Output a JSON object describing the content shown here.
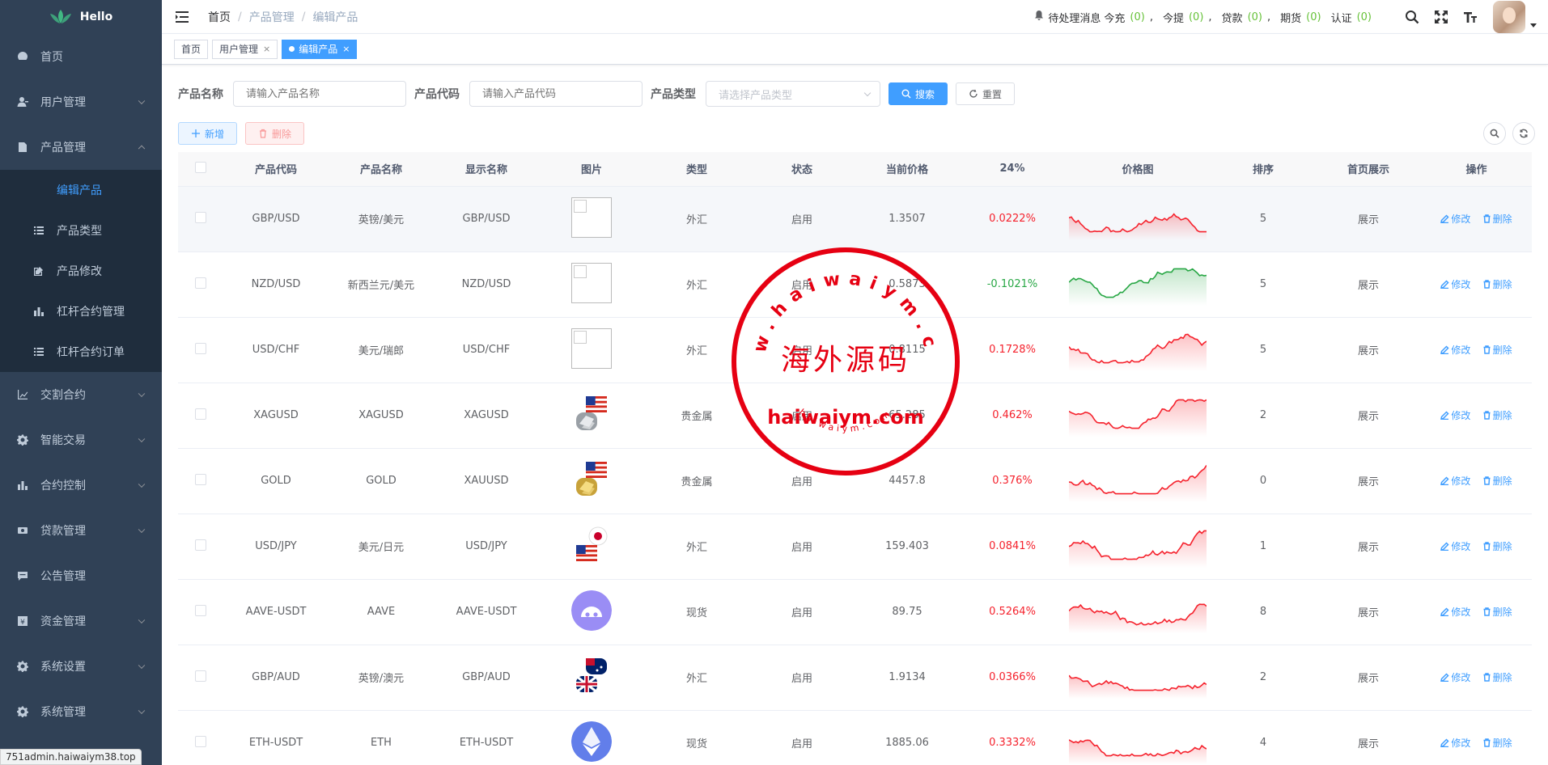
{
  "app": {
    "logo_text": "Hello",
    "status_url": "751admin.haiwaiym38.top"
  },
  "sidebar": {
    "items": [
      {
        "label": "首页",
        "icon": "dashboard-icon",
        "arrow": false
      },
      {
        "label": "用户管理",
        "icon": "user-icon",
        "arrow": true
      },
      {
        "label": "产品管理",
        "icon": "document-icon",
        "arrow": true,
        "open": true,
        "children": [
          {
            "label": "编辑产品",
            "icon": "",
            "active": true
          },
          {
            "label": "产品类型",
            "icon": "list-icon"
          },
          {
            "label": "产品修改",
            "icon": "edit-icon"
          },
          {
            "label": "杠杆合约管理",
            "icon": "bar-chart-icon"
          },
          {
            "label": "杠杆合约订单",
            "icon": "list-icon"
          }
        ]
      },
      {
        "label": "交割合约",
        "icon": "trend-icon",
        "arrow": true
      },
      {
        "label": "智能交易",
        "icon": "cog-icon",
        "arrow": true
      },
      {
        "label": "合约控制",
        "icon": "bar-chart-icon",
        "arrow": true
      },
      {
        "label": "贷款管理",
        "icon": "loan-icon",
        "arrow": true
      },
      {
        "label": "公告管理",
        "icon": "message-icon",
        "arrow": false
      },
      {
        "label": "资金管理",
        "icon": "money-icon",
        "arrow": true
      },
      {
        "label": "系统设置",
        "icon": "gear-icon",
        "arrow": true
      },
      {
        "label": "系统管理",
        "icon": "gear-icon",
        "arrow": true
      }
    ]
  },
  "header": {
    "breadcrumb": [
      "首页",
      "产品管理",
      "编辑产品"
    ],
    "notice": {
      "label": "待处理消息",
      "items": [
        {
          "label": "今充",
          "count": "(0)"
        },
        {
          "label": "今提",
          "count": "(0)"
        },
        {
          "label": "贷款",
          "count": "(0)"
        },
        {
          "label": "期货",
          "count": "(0)"
        },
        {
          "label": "认证",
          "count": "(0)"
        }
      ]
    }
  },
  "tags": [
    {
      "label": "首页",
      "active": false,
      "closable": false
    },
    {
      "label": "用户管理",
      "active": false,
      "closable": true
    },
    {
      "label": "编辑产品",
      "active": true,
      "closable": true
    }
  ],
  "search": {
    "name_label": "产品名称",
    "name_placeholder": "请输入产品名称",
    "code_label": "产品代码",
    "code_placeholder": "请输入产品代码",
    "type_label": "产品类型",
    "type_placeholder": "请选择产品类型",
    "search_btn": "搜索",
    "reset_btn": "重置"
  },
  "actions": {
    "add": "新增",
    "delete": "删除"
  },
  "table": {
    "headers": [
      "产品代码",
      "产品名称",
      "显示名称",
      "图片",
      "类型",
      "状态",
      "当前价格",
      "24%",
      "价格图",
      "排序",
      "首页展示",
      "操作"
    ],
    "edit_label": "修改",
    "delete_label": "删除",
    "rows": [
      {
        "code": "GBP/USD",
        "name": "英镑/美元",
        "display": "GBP/USD",
        "img": "broken",
        "type": "外汇",
        "status": "启用",
        "price": "1.3507",
        "pct": "0.0222%",
        "up": true,
        "sort": "5",
        "show": "展示",
        "seed": 1
      },
      {
        "code": "NZD/USD",
        "name": "新西兰元/美元",
        "display": "NZD/USD",
        "img": "broken",
        "type": "外汇",
        "status": "启用",
        "price": "0.5873",
        "pct": "-0.1021%",
        "up": false,
        "sort": "5",
        "show": "展示",
        "seed": 2
      },
      {
        "code": "USD/CHF",
        "name": "美元/瑞郎",
        "display": "USD/CHF",
        "img": "broken",
        "type": "外汇",
        "status": "启用",
        "price": "0.8115",
        "pct": "0.1728%",
        "up": true,
        "sort": "5",
        "show": "展示",
        "seed": 3
      },
      {
        "code": "XAGUSD",
        "name": "XAGUSD",
        "display": "XAGUSD",
        "img": "silver",
        "type": "贵金属",
        "status": "启用",
        "price": "65.285",
        "pct": "0.462%",
        "up": true,
        "sort": "2",
        "show": "展示",
        "seed": 4
      },
      {
        "code": "GOLD",
        "name": "GOLD",
        "display": "XAUUSD",
        "img": "gold",
        "type": "贵金属",
        "status": "启用",
        "price": "4457.8",
        "pct": "0.376%",
        "up": true,
        "sort": "0",
        "show": "展示",
        "seed": 5
      },
      {
        "code": "USD/JPY",
        "name": "美元/日元",
        "display": "USD/JPY",
        "img": "jpy",
        "type": "外汇",
        "status": "启用",
        "price": "159.403",
        "pct": "0.0841%",
        "up": true,
        "sort": "1",
        "show": "展示",
        "seed": 6
      },
      {
        "code": "AAVE-USDT",
        "name": "AAVE",
        "display": "AAVE-USDT",
        "img": "aave",
        "type": "现货",
        "status": "启用",
        "price": "89.75",
        "pct": "0.5264%",
        "up": true,
        "sort": "8",
        "show": "展示",
        "seed": 7
      },
      {
        "code": "GBP/AUD",
        "name": "英镑/澳元",
        "display": "GBP/AUD",
        "img": "gbpaud",
        "type": "外汇",
        "status": "启用",
        "price": "1.9134",
        "pct": "0.0366%",
        "up": true,
        "sort": "2",
        "show": "展示",
        "seed": 8
      },
      {
        "code": "ETH-USDT",
        "name": "ETH",
        "display": "ETH-USDT",
        "img": "eth",
        "type": "现货",
        "status": "启用",
        "price": "1885.06",
        "pct": "0.3332%",
        "up": true,
        "sort": "4",
        "show": "展示",
        "seed": 9
      }
    ]
  },
  "watermark": {
    "top": "www.haiwaiym.com",
    "center": "海外源码",
    "bottom": "haiwaiym.com",
    "small": "haiwaiym.com"
  },
  "colors": {
    "sidebar_bg": "#304156",
    "submenu_bg": "#1f2d3d",
    "primary": "#409eff",
    "up": "#f5222d",
    "down": "#28a745",
    "stamp": "#e60012"
  }
}
